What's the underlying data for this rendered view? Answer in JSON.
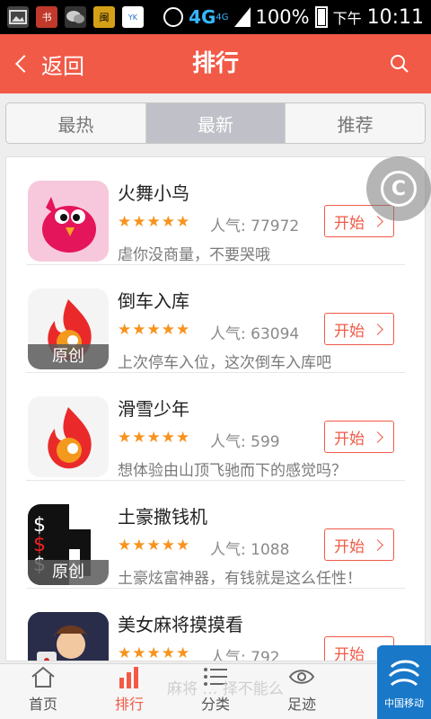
{
  "status_bar": {
    "network": "4G",
    "network_sup": "4G",
    "battery": "100%",
    "ampm": "下午",
    "time": "10:11",
    "app_icons": [
      "image-icon",
      "reader-icon",
      "wechat-icon",
      "app-icon",
      "youku-icon"
    ]
  },
  "header": {
    "back_label": "返回",
    "title": "排行"
  },
  "segments": {
    "tabs": [
      "最热",
      "最新",
      "推荐"
    ],
    "active": "最新"
  },
  "apps": [
    {
      "name": "火舞小鸟",
      "stars": "★★★★★",
      "popularity": "人气: 77972",
      "desc": "虐你没商量，不要哭哦",
      "badge": "",
      "button": "开始"
    },
    {
      "name": "倒车入库",
      "stars": "★★★★★",
      "popularity": "人气: 63094",
      "desc": "上次停车入位，这次倒车入库吧",
      "badge": "原创",
      "button": "开始"
    },
    {
      "name": "滑雪少年",
      "stars": "★★★★★",
      "popularity": "人气: 599",
      "desc": "想体验由山顶飞驰而下的感觉吗？",
      "badge": "",
      "button": "开始"
    },
    {
      "name": "土豪撒钱机",
      "stars": "★★★★★",
      "popularity": "人气: 1088",
      "desc": "土豪炫富神器，有钱就是这么任性！",
      "badge": "原创",
      "button": "开始"
    },
    {
      "name": "美女麻将摸摸看",
      "stars": "★★★★★",
      "popularity": "人气: 792",
      "desc": "",
      "badge": "",
      "button": "开始"
    }
  ],
  "float_ball": {
    "letter": "C"
  },
  "tabbar": {
    "items": [
      "首页",
      "排行",
      "分类",
      "足迹"
    ],
    "active": "排行",
    "ghost_text": "麻将 … 择不能么"
  },
  "carrier": {
    "name": "中国移动"
  },
  "colors": {
    "accent": "#f15a47",
    "star": "#f7931e",
    "carrier": "#1978c8"
  }
}
